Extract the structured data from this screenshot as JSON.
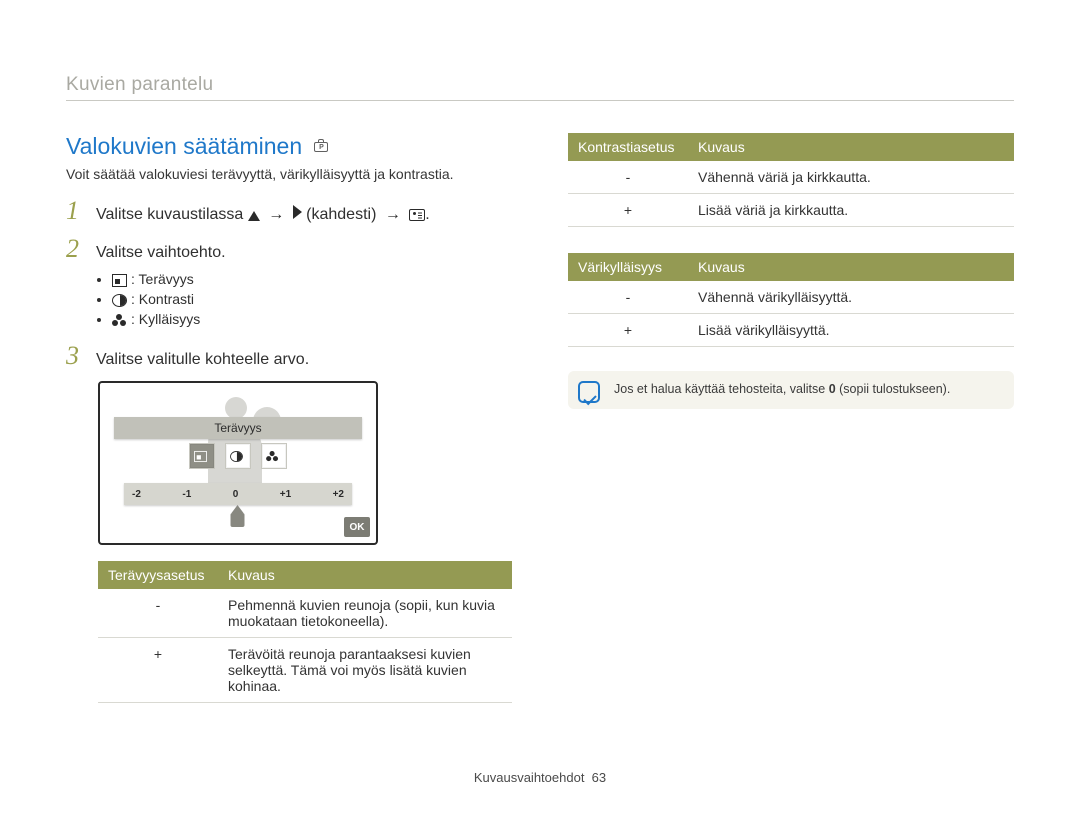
{
  "section_title": "Kuvien parantelu",
  "heading": "Valokuvien säätäminen",
  "intro": "Voit säätää valokuviesi terävyyttä, värikylläisyyttä ja kontrastia.",
  "step1": {
    "prefix": "Valitse kuvaustilassa",
    "mid": "(kahdesti)",
    "period": "."
  },
  "step2": "Valitse vaihtoehto.",
  "bullets": {
    "sharp": ": Terävyys",
    "contrast": ": Kontrasti",
    "sat": ": Kylläisyys"
  },
  "step3": "Valitse valitulle kohteelle arvo.",
  "screen": {
    "title": "Terävyys",
    "scale": {
      "m2": "-2",
      "m1": "-1",
      "z": "0",
      "p1": "+1",
      "p2": "+2"
    },
    "ok": "OK"
  },
  "table_sharp": {
    "h1": "Terävyysasetus",
    "h2": "Kuvaus",
    "r1_sym": "-",
    "r1_desc": "Pehmennä kuvien reunoja (sopii, kun kuvia muokataan tietokoneella).",
    "r2_sym": "+",
    "r2_desc": "Terävöitä reunoja parantaaksesi kuvien selkeyttä. Tämä voi myös lisätä kuvien kohinaa."
  },
  "table_contrast": {
    "h1": "Kontrastiasetus",
    "h2": "Kuvaus",
    "r1_sym": "-",
    "r1_desc": "Vähennä väriä ja kirkkautta.",
    "r2_sym": "+",
    "r2_desc": "Lisää väriä ja kirkkautta."
  },
  "table_sat": {
    "h1": "Värikylläisyys",
    "h2": "Kuvaus",
    "r1_sym": "-",
    "r1_desc": "Vähennä värikylläisyyttä.",
    "r2_sym": "+",
    "r2_desc": "Lisää värikylläisyyttä."
  },
  "note": {
    "pre": "Jos et halua käyttää tehosteita, valitse ",
    "bold": "0",
    "post": " (sopii tulostukseen)."
  },
  "footer": {
    "label": "Kuvausvaihtoehdot",
    "page": "63"
  }
}
